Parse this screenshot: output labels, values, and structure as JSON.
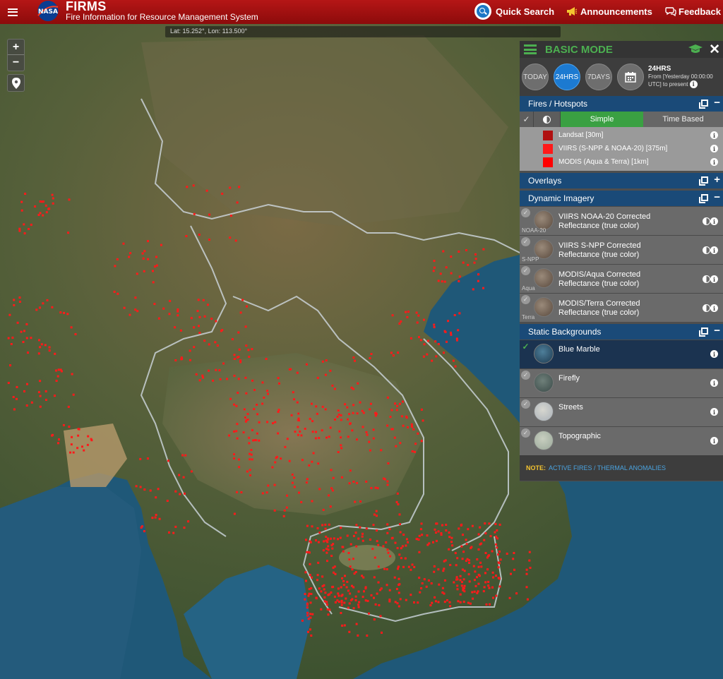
{
  "header": {
    "app_name": "FIRMS",
    "subtitle": "Fire Information for Resource Management System",
    "logo_text": "NASA",
    "quick_search": "Quick Search",
    "announcements": "Announcements",
    "feedback": "Feedback"
  },
  "map": {
    "coords": "Lat: 15.252°, Lon: 113.500°",
    "zoom_in": "+",
    "zoom_out": "−"
  },
  "panel": {
    "mode_title": "BASIC MODE",
    "time": {
      "today": "TODAY",
      "hrs24": "24HRS",
      "days7": "7DAYS",
      "selected_label": "24HRS",
      "range_text": "From [Yesterday 00:00:00 UTC] to present"
    },
    "fires": {
      "title": "Fires / Hotspots",
      "simple": "Simple",
      "time_based": "Time Based",
      "layers": [
        {
          "label": "Landsat [30m]",
          "color": "#b01010"
        },
        {
          "label": "VIIRS (S-NPP & NOAA-20) [375m]",
          "color": "#ff1a1a"
        },
        {
          "label": "MODIS (Aqua & Terra) [1km]",
          "color": "#ff0000"
        }
      ]
    },
    "overlays": {
      "title": "Overlays"
    },
    "dynamic": {
      "title": "Dynamic Imagery",
      "items": [
        {
          "line1": "VIIRS NOAA-20 Corrected",
          "line2": "Reflectance (true color)",
          "tag": "NOAA-20"
        },
        {
          "line1": "VIIRS S-NPP Corrected",
          "line2": "Reflectance (true color)",
          "tag": "S-NPP"
        },
        {
          "line1": "MODIS/Aqua Corrected",
          "line2": "Reflectance (true color)",
          "tag": "Aqua"
        },
        {
          "line1": "MODIS/Terra Corrected",
          "line2": "Reflectance (true color)",
          "tag": "Terra"
        }
      ]
    },
    "static": {
      "title": "Static Backgrounds",
      "items": [
        {
          "label": "Blue Marble"
        },
        {
          "label": "Firefly"
        },
        {
          "label": "Streets"
        },
        {
          "label": "Topographic"
        }
      ]
    },
    "note": {
      "label": "NOTE:",
      "text": "ACTIVE FIRES / THERMAL ANOMALIES"
    }
  }
}
